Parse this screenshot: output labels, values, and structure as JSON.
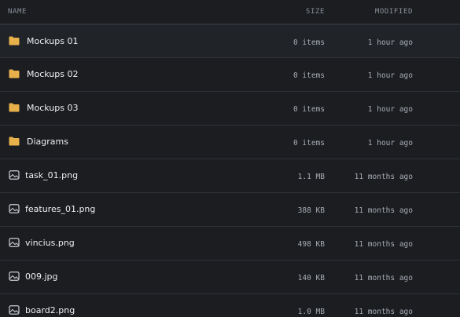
{
  "columns": {
    "name": "NAME",
    "size": "SIZE",
    "modified": "MODIFIED"
  },
  "colors": {
    "background": "#1b1d21",
    "divider": "#2e3137",
    "folder_icon": "#e8b04a",
    "file_icon": "#c9ccd1"
  },
  "rows": [
    {
      "type": "folder",
      "icon": "folder-icon",
      "name": "Mockups 01",
      "size": "0 items",
      "modified": "1 hour ago"
    },
    {
      "type": "folder",
      "icon": "folder-icon",
      "name": "Mockups 02",
      "size": "0 items",
      "modified": "1 hour ago"
    },
    {
      "type": "folder",
      "icon": "folder-icon",
      "name": "Mockups 03",
      "size": "0 items",
      "modified": "1 hour ago"
    },
    {
      "type": "folder",
      "icon": "folder-icon",
      "name": "Diagrams",
      "size": "0 items",
      "modified": "1 hour ago"
    },
    {
      "type": "file",
      "icon": "image-file-icon",
      "name": "task_01.png",
      "size": "1.1 MB",
      "modified": "11 months ago"
    },
    {
      "type": "file",
      "icon": "image-file-icon",
      "name": "features_01.png",
      "size": "388 KB",
      "modified": "11 months ago"
    },
    {
      "type": "file",
      "icon": "image-file-icon",
      "name": "vincius.png",
      "size": "498 KB",
      "modified": "11 months ago"
    },
    {
      "type": "file",
      "icon": "image-file-icon",
      "name": "009.jpg",
      "size": "140 KB",
      "modified": "11 months ago"
    },
    {
      "type": "file",
      "icon": "image-file-icon",
      "name": "board2.png",
      "size": "1.0 MB",
      "modified": "11 months ago"
    }
  ]
}
